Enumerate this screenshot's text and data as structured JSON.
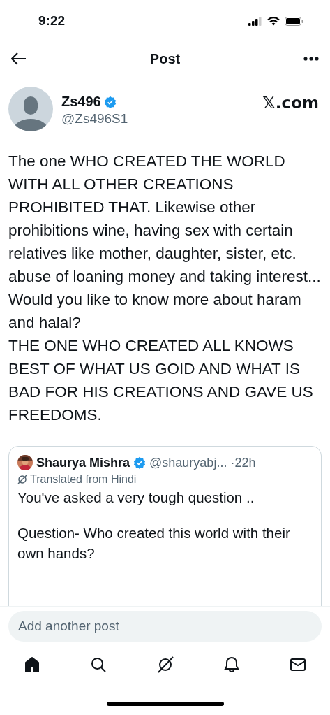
{
  "status_bar": {
    "time": "9:22"
  },
  "header": {
    "title": "Post"
  },
  "author": {
    "name": "Zs496",
    "handle": "@Zs496S1",
    "source": "𝕏.com"
  },
  "post": {
    "paragraphs": [
      "The one WHO CREATED THE WORLD WITH ALL OTHER CREATIONS PROHIBITED THAT. Likewise other prohibitions wine, having sex with certain relatives like mother, daughter, sister, etc. abuse of loaning money and taking interest...",
      "Would you like to know more about haram and halal?",
      "THE ONE WHO CREATED ALL KNOWS BEST OF WHAT US GOID AND WHAT IS BAD FOR HIS CREATIONS AND GAVE US FREEDOMS."
    ]
  },
  "quoted_post": {
    "name": "Shaurya Mishra",
    "handle": "@shauryabj...",
    "time": "·22h",
    "translation_note": "Translated from Hindi",
    "paragraphs": [
      "You've asked a very tough question ..",
      "Question- Who created this world with their own hands?"
    ]
  },
  "reply_field": {
    "placeholder": "Add another post"
  },
  "tab_bar": [
    {
      "kind": "home",
      "selected": true
    },
    {
      "kind": "search",
      "selected": false
    },
    {
      "kind": "grok",
      "selected": false
    },
    {
      "kind": "notifications",
      "selected": false
    },
    {
      "kind": "messages",
      "selected": false
    }
  ]
}
